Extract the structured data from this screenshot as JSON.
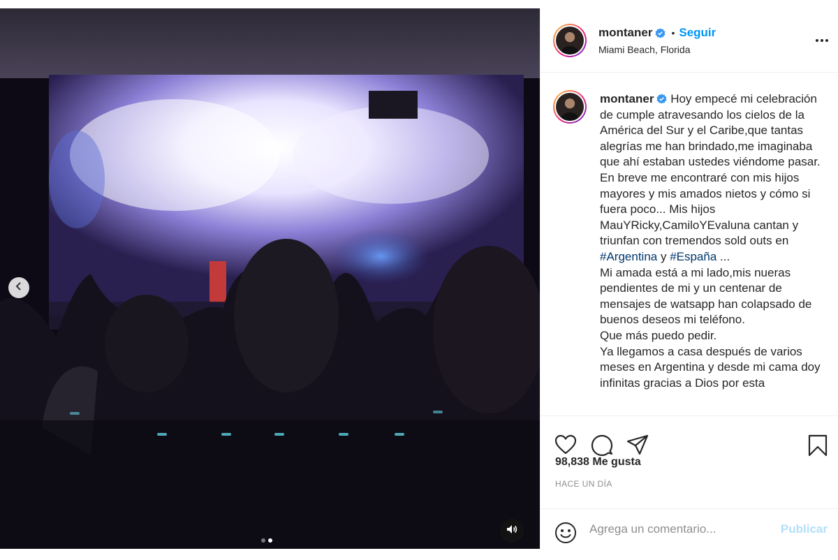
{
  "post": {
    "username": "montaner",
    "follow_label": "Seguir",
    "separator": "•",
    "location": "Miami Beach, Florida",
    "caption_username": "montaner",
    "caption_parts": [
      "Hoy empecé mi celebración de cumple atravesando los cielos de la América del Sur y el Caribe,que tantas alegrías me han brindado,me imaginaba que ahí estaban ustedes viéndome pasar.\nEn breve me encontraré con mis hijos mayores y mis amados nietos y cómo si fuera poco... Mis hijos MauYRicky,CamiloYEvaluna cantan y triunfan con tremendos sold outs en ",
      " y ",
      " ...\nMi amada está a mi lado,mis nueras pendientes de mi y un centenar de mensajes de watsapp han colapsado de buenos deseos mi teléfono.\nQue más puedo pedir.\nYa llegamos a casa después de varios meses en Argentina y desde mi cama doy infinitas gracias a Dios por esta"
    ],
    "hashtags": [
      "#Argentina",
      "#España"
    ],
    "likes": "98,838 Me gusta",
    "time": "HACE UN DÍA",
    "comment_placeholder": "Agrega un comentario...",
    "publish_label": "Publicar"
  },
  "media": {
    "carousel_total": 2,
    "carousel_active": 2
  },
  "icons": {
    "verified": "verified-badge-icon",
    "more": "more-options-icon",
    "like": "heart-icon",
    "comment": "comment-icon",
    "share": "share-icon",
    "save": "bookmark-icon",
    "emoji": "emoji-icon",
    "prev": "chevron-left-icon",
    "mute": "speaker-icon"
  },
  "colors": {
    "accent": "#0095f6",
    "hashtag": "#00376b",
    "muted": "#8e8e8e",
    "publish_disabled": "#b2dffc"
  }
}
